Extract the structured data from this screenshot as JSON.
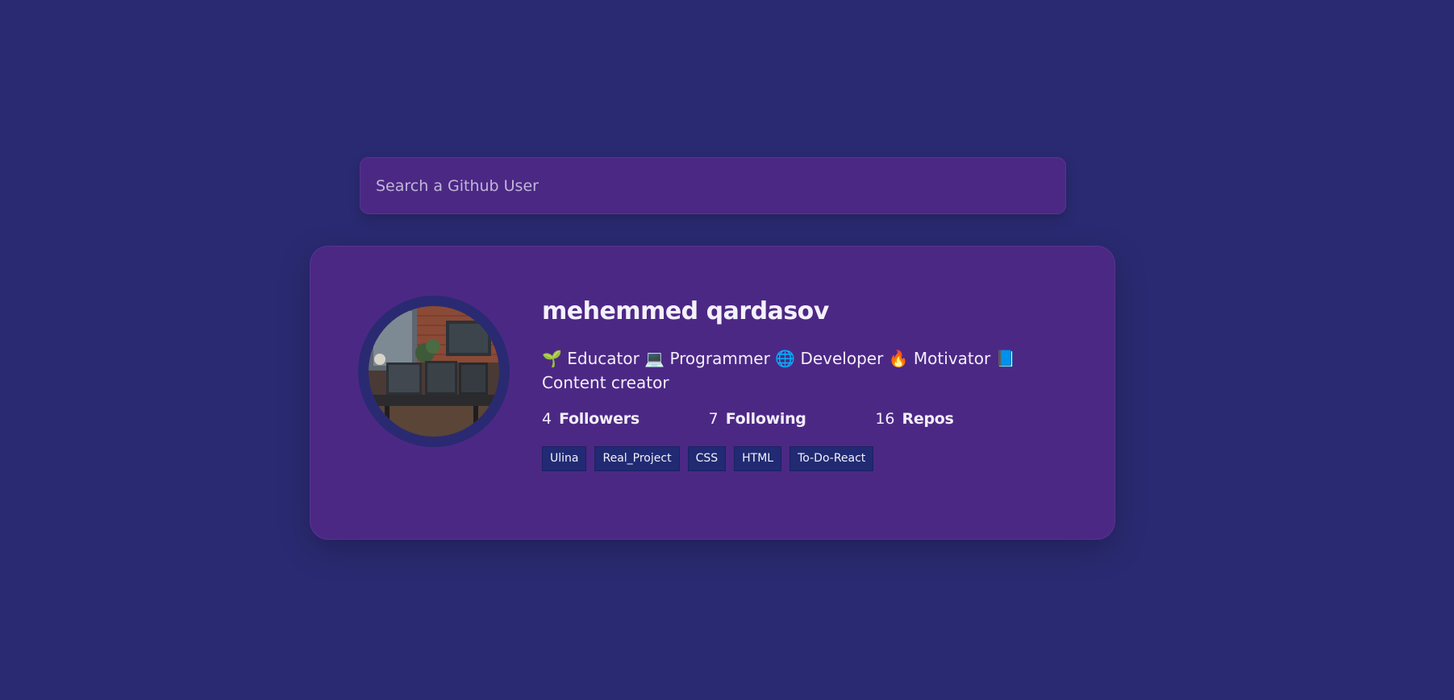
{
  "search": {
    "placeholder": "Search a Github User",
    "value": ""
  },
  "profile": {
    "name": "mehemmed qardasov",
    "avatar_icon": "avatar-photo-icon",
    "bio": "🌱 Educator 💻 Programmer 🌐 Developer 🔥 Motivator 📘 Content creator",
    "followers": {
      "count": "4",
      "label": "Followers"
    },
    "following": {
      "count": "7",
      "label": "Following"
    },
    "repos_stat": {
      "count": "16",
      "label": "Repos"
    },
    "repos": [
      "Ulina",
      "Real_Project",
      "CSS",
      "HTML",
      "To-Do-React"
    ]
  },
  "colors": {
    "background": "#2a2a72",
    "card": "#4c2885",
    "repo_tag": "#212a72",
    "text": "#ffffff"
  }
}
